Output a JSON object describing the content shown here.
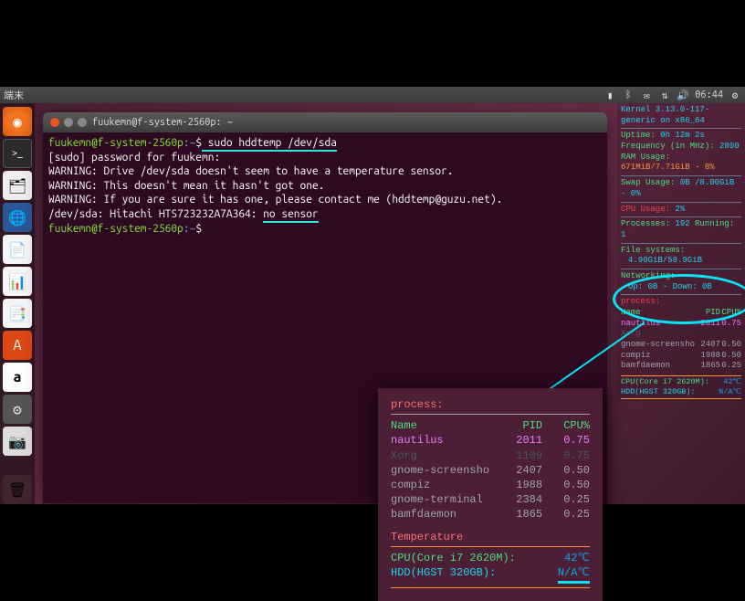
{
  "topbar": {
    "left_label": "端末",
    "time": "06:44"
  },
  "launcher": {
    "items": [
      {
        "name": "ubuntu-dash",
        "glyph": "◌"
      },
      {
        "name": "terminal",
        "glyph": ">_"
      },
      {
        "name": "files",
        "glyph": "📁"
      },
      {
        "name": "firefox",
        "glyph": "🦊"
      },
      {
        "name": "libreoffice-writer",
        "glyph": "📄"
      },
      {
        "name": "libreoffice-calc",
        "glyph": "📊"
      },
      {
        "name": "libreoffice-impress",
        "glyph": "📋"
      },
      {
        "name": "software-center",
        "glyph": "A"
      },
      {
        "name": "amazon",
        "glyph": "a"
      },
      {
        "name": "settings",
        "glyph": "⚙"
      },
      {
        "name": "screenshot",
        "glyph": "📷"
      },
      {
        "name": "trash",
        "glyph": "🗑"
      }
    ]
  },
  "terminal": {
    "title": "fuukemn@f-system-2560p: ~",
    "lines": {
      "prompt_user1": "fuukemn@f-system-2560p",
      "prompt_path1": "~",
      "cmd1": " sudo hddtemp /dev/sda",
      "l2": "[sudo] password for fuukemn:",
      "l3": "WARNING: Drive /dev/sda doesn't seem to have a temperature sensor.",
      "l4": "WARNING: This doesn't mean it hasn't got one.",
      "l5": "WARNING: If you are sure it has one, please contact me (hddtemp@guzu.net).",
      "l6_a": "/dev/sda: Hitachi HTS723232A7A364:  ",
      "l6_b": "no sensor",
      "prompt_user2": "fuukemn@f-system-2560p",
      "prompt_path2": "~"
    }
  },
  "conky": {
    "kernel": "Kernel 3.13.0-117-generic on x86_64",
    "uptime_lbl": "Uptime:",
    "uptime_val": "0h 12m 2s",
    "freq_lbl": "Frequency (in MHz):",
    "freq_val": "2800",
    "ram_lbl": "RAM Usage:",
    "ram_val": "671MiB/7.71GiB - 8%",
    "swap_lbl": "Swap Usage:",
    "swap_val": "0B  /8.00GiB - 0%",
    "cpu_lbl": "CPU Usage:",
    "cpu_val": "2%",
    "proc_lbl": "Processes:",
    "proc_val": "192",
    "run_lbl": "Running:",
    "run_val": "1",
    "fs_lbl": "File systems:",
    "fs_val": "4.90GiB/58.9GiB",
    "net_lbl": "Networking:",
    "net_up": "Up: 0B",
    "net_down": "- Down: 0B",
    "process_hdr": "process:",
    "cols": {
      "name": "Name",
      "pid": "PID",
      "cpu": "CPU%"
    },
    "rows": [
      {
        "name": "nautilus",
        "pid": "2011",
        "cpu": "0.75"
      },
      {
        "name": "Xorg",
        "pid": "",
        "cpu": ""
      },
      {
        "name": "gnome-screensho",
        "pid": "2407",
        "cpu": "0.50"
      },
      {
        "name": "compiz",
        "pid": "1988",
        "cpu": "0.50"
      },
      {
        "name": "gnome-terminal",
        "pid": "",
        "cpu": ""
      },
      {
        "name": "bamfdaemon",
        "pid": "1865",
        "cpu": "0.25"
      }
    ],
    "temp_hdr": "Temperature",
    "temp_cpu_lbl": "CPU(Core i7 2620M):",
    "temp_cpu_val": "42℃",
    "temp_hdd_lbl": "HDD(HGST   320GB):",
    "temp_hdd_val": "N/A℃"
  },
  "zoom": {
    "process_hdr": "process:",
    "cols": {
      "name": "Name",
      "pid": "PID",
      "cpu": "CPU%"
    },
    "rows": [
      {
        "name": "nautilus",
        "pid": "2011",
        "cpu": "0.75",
        "cls": "nautilus"
      },
      {
        "name": "Xorg",
        "pid": "1109",
        "cpu": "0.75",
        "cls": "xorg"
      },
      {
        "name": "gnome-screensho",
        "pid": "2407",
        "cpu": "0.50",
        "cls": ""
      },
      {
        "name": "compiz",
        "pid": "1988",
        "cpu": "0.50",
        "cls": ""
      },
      {
        "name": "gnome-terminal",
        "pid": "2384",
        "cpu": "0.25",
        "cls": ""
      },
      {
        "name": "bamfdaemon",
        "pid": "1865",
        "cpu": "0.25",
        "cls": ""
      }
    ],
    "temp_hdr": "Temperature",
    "temp_cpu_lbl": "CPU(Core i7 2620M):",
    "temp_cpu_val": "42℃",
    "temp_hdd_lbl": "HDD(HGST   320GB):",
    "temp_hdd_val": "N/A℃"
  }
}
